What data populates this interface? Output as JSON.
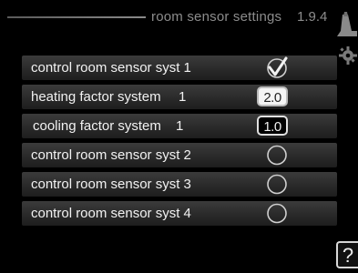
{
  "header": {
    "title": "room sensor settings",
    "menu_number": "1.9.4"
  },
  "rows": [
    {
      "label": "control room sensor syst 1",
      "control": "radio",
      "checked": true
    },
    {
      "label": "heating factor system",
      "system": "1",
      "control": "value",
      "value": "2.0",
      "selected": true
    },
    {
      "label": "cooling factor system",
      "system": "1",
      "control": "value",
      "value": "1.0",
      "selected": false
    },
    {
      "label": "control room sensor syst 2",
      "control": "radio",
      "checked": false
    },
    {
      "label": "control room sensor syst 3",
      "control": "radio",
      "checked": false
    },
    {
      "label": "control room sensor syst 4",
      "control": "radio",
      "checked": false
    }
  ],
  "icons": {
    "top_right": "thermometer-icon",
    "side": "gear-icon",
    "help": "help-icon",
    "help_glyph": "?"
  }
}
